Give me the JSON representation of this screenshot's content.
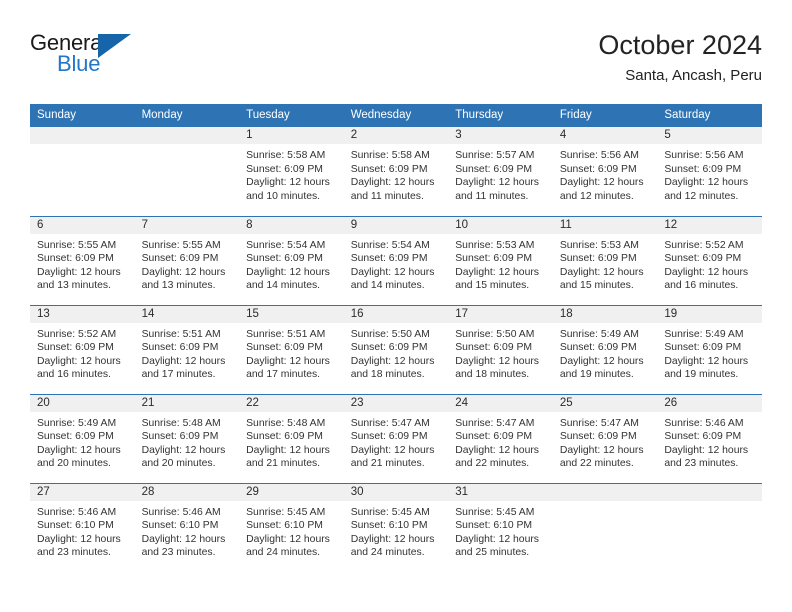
{
  "branding": {
    "logo_word_1": "General",
    "logo_word_2": "Blue",
    "logo_icon": "blue-triangle-flag"
  },
  "header": {
    "title": "October 2024",
    "subtitle": "Santa, Ancash, Peru"
  },
  "colors": {
    "header_blue": "#2e74b5",
    "daynum_band": "#f0f0f0",
    "logo_blue": "#2277c8",
    "text": "#333333"
  },
  "calendar": {
    "weekday_headers": [
      "Sunday",
      "Monday",
      "Tuesday",
      "Wednesday",
      "Thursday",
      "Friday",
      "Saturday"
    ],
    "weeks": [
      [
        {
          "day": "",
          "lines": []
        },
        {
          "day": "",
          "lines": []
        },
        {
          "day": "1",
          "lines": [
            "Sunrise: 5:58 AM",
            "Sunset: 6:09 PM",
            "Daylight: 12 hours",
            "and 10 minutes."
          ]
        },
        {
          "day": "2",
          "lines": [
            "Sunrise: 5:58 AM",
            "Sunset: 6:09 PM",
            "Daylight: 12 hours",
            "and 11 minutes."
          ]
        },
        {
          "day": "3",
          "lines": [
            "Sunrise: 5:57 AM",
            "Sunset: 6:09 PM",
            "Daylight: 12 hours",
            "and 11 minutes."
          ]
        },
        {
          "day": "4",
          "lines": [
            "Sunrise: 5:56 AM",
            "Sunset: 6:09 PM",
            "Daylight: 12 hours",
            "and 12 minutes."
          ]
        },
        {
          "day": "5",
          "lines": [
            "Sunrise: 5:56 AM",
            "Sunset: 6:09 PM",
            "Daylight: 12 hours",
            "and 12 minutes."
          ]
        }
      ],
      [
        {
          "day": "6",
          "lines": [
            "Sunrise: 5:55 AM",
            "Sunset: 6:09 PM",
            "Daylight: 12 hours",
            "and 13 minutes."
          ]
        },
        {
          "day": "7",
          "lines": [
            "Sunrise: 5:55 AM",
            "Sunset: 6:09 PM",
            "Daylight: 12 hours",
            "and 13 minutes."
          ]
        },
        {
          "day": "8",
          "lines": [
            "Sunrise: 5:54 AM",
            "Sunset: 6:09 PM",
            "Daylight: 12 hours",
            "and 14 minutes."
          ]
        },
        {
          "day": "9",
          "lines": [
            "Sunrise: 5:54 AM",
            "Sunset: 6:09 PM",
            "Daylight: 12 hours",
            "and 14 minutes."
          ]
        },
        {
          "day": "10",
          "lines": [
            "Sunrise: 5:53 AM",
            "Sunset: 6:09 PM",
            "Daylight: 12 hours",
            "and 15 minutes."
          ]
        },
        {
          "day": "11",
          "lines": [
            "Sunrise: 5:53 AM",
            "Sunset: 6:09 PM",
            "Daylight: 12 hours",
            "and 15 minutes."
          ]
        },
        {
          "day": "12",
          "lines": [
            "Sunrise: 5:52 AM",
            "Sunset: 6:09 PM",
            "Daylight: 12 hours",
            "and 16 minutes."
          ]
        }
      ],
      [
        {
          "day": "13",
          "lines": [
            "Sunrise: 5:52 AM",
            "Sunset: 6:09 PM",
            "Daylight: 12 hours",
            "and 16 minutes."
          ]
        },
        {
          "day": "14",
          "lines": [
            "Sunrise: 5:51 AM",
            "Sunset: 6:09 PM",
            "Daylight: 12 hours",
            "and 17 minutes."
          ]
        },
        {
          "day": "15",
          "lines": [
            "Sunrise: 5:51 AM",
            "Sunset: 6:09 PM",
            "Daylight: 12 hours",
            "and 17 minutes."
          ]
        },
        {
          "day": "16",
          "lines": [
            "Sunrise: 5:50 AM",
            "Sunset: 6:09 PM",
            "Daylight: 12 hours",
            "and 18 minutes."
          ]
        },
        {
          "day": "17",
          "lines": [
            "Sunrise: 5:50 AM",
            "Sunset: 6:09 PM",
            "Daylight: 12 hours",
            "and 18 minutes."
          ]
        },
        {
          "day": "18",
          "lines": [
            "Sunrise: 5:49 AM",
            "Sunset: 6:09 PM",
            "Daylight: 12 hours",
            "and 19 minutes."
          ]
        },
        {
          "day": "19",
          "lines": [
            "Sunrise: 5:49 AM",
            "Sunset: 6:09 PM",
            "Daylight: 12 hours",
            "and 19 minutes."
          ]
        }
      ],
      [
        {
          "day": "20",
          "lines": [
            "Sunrise: 5:49 AM",
            "Sunset: 6:09 PM",
            "Daylight: 12 hours",
            "and 20 minutes."
          ]
        },
        {
          "day": "21",
          "lines": [
            "Sunrise: 5:48 AM",
            "Sunset: 6:09 PM",
            "Daylight: 12 hours",
            "and 20 minutes."
          ]
        },
        {
          "day": "22",
          "lines": [
            "Sunrise: 5:48 AM",
            "Sunset: 6:09 PM",
            "Daylight: 12 hours",
            "and 21 minutes."
          ]
        },
        {
          "day": "23",
          "lines": [
            "Sunrise: 5:47 AM",
            "Sunset: 6:09 PM",
            "Daylight: 12 hours",
            "and 21 minutes."
          ]
        },
        {
          "day": "24",
          "lines": [
            "Sunrise: 5:47 AM",
            "Sunset: 6:09 PM",
            "Daylight: 12 hours",
            "and 22 minutes."
          ]
        },
        {
          "day": "25",
          "lines": [
            "Sunrise: 5:47 AM",
            "Sunset: 6:09 PM",
            "Daylight: 12 hours",
            "and 22 minutes."
          ]
        },
        {
          "day": "26",
          "lines": [
            "Sunrise: 5:46 AM",
            "Sunset: 6:09 PM",
            "Daylight: 12 hours",
            "and 23 minutes."
          ]
        }
      ],
      [
        {
          "day": "27",
          "lines": [
            "Sunrise: 5:46 AM",
            "Sunset: 6:10 PM",
            "Daylight: 12 hours",
            "and 23 minutes."
          ]
        },
        {
          "day": "28",
          "lines": [
            "Sunrise: 5:46 AM",
            "Sunset: 6:10 PM",
            "Daylight: 12 hours",
            "and 23 minutes."
          ]
        },
        {
          "day": "29",
          "lines": [
            "Sunrise: 5:45 AM",
            "Sunset: 6:10 PM",
            "Daylight: 12 hours",
            "and 24 minutes."
          ]
        },
        {
          "day": "30",
          "lines": [
            "Sunrise: 5:45 AM",
            "Sunset: 6:10 PM",
            "Daylight: 12 hours",
            "and 24 minutes."
          ]
        },
        {
          "day": "31",
          "lines": [
            "Sunrise: 5:45 AM",
            "Sunset: 6:10 PM",
            "Daylight: 12 hours",
            "and 25 minutes."
          ]
        },
        {
          "day": "",
          "lines": []
        },
        {
          "day": "",
          "lines": []
        }
      ]
    ]
  }
}
